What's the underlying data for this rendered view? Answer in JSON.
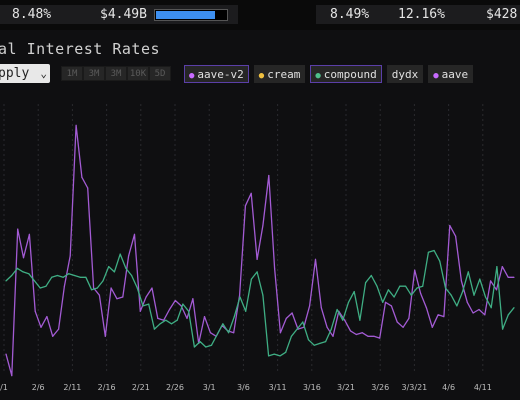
{
  "topbar": {
    "left": {
      "rate": "8.48%",
      "volume": "$4.49B",
      "fill": 0.82
    },
    "right": {
      "rate1": "8.49%",
      "rate2": "12.16%",
      "amount": "$428"
    }
  },
  "title": "al Interest Rates",
  "controls": {
    "select_value": "pply",
    "ranges": [
      "1M",
      "3M",
      "3M",
      "10K",
      "5D"
    ],
    "protocols": [
      {
        "label": "aave-v2",
        "dot": "#c86bff",
        "active": true
      },
      {
        "label": "cream",
        "dot": "#f0c040",
        "active": false
      },
      {
        "label": "compound",
        "dot": "#4ec08a",
        "active": true
      },
      {
        "label": "dydx",
        "dot": "",
        "active": false
      },
      {
        "label": "aave",
        "dot": "#c86bff",
        "active": false
      }
    ]
  },
  "colors": {
    "aave_v2": "#a35bd4",
    "compound": "#3fae84",
    "grid": "#2a2a2e",
    "axis_text": "#bdbdbd"
  },
  "chart_data": {
    "type": "line",
    "x_tick_labels": [
      "/1",
      "2/6",
      "2/11",
      "2/16",
      "2/21",
      "2/26",
      "3/1",
      "3/6",
      "3/11",
      "3/16",
      "3/21",
      "3/26",
      "3/3/21",
      "4/6",
      "4/11"
    ],
    "series": [
      {
        "name": "aave-v2",
        "values": [
          6,
          4.8,
          13,
          11.4,
          12.7,
          8.4,
          7.5,
          8.1,
          7,
          7.4,
          9.8,
          11.5,
          18.8,
          15.9,
          15.3,
          9.7,
          9.3,
          7,
          9.7,
          9.1,
          9.2,
          11.5,
          12.7,
          8.4,
          9.2,
          9.7,
          8,
          7.9,
          8.5,
          9,
          8.7,
          8,
          9.1,
          6.6,
          8.1,
          7.2,
          7,
          7.6,
          7.3,
          7.2,
          9.3,
          14.3,
          15,
          11.3,
          13.2,
          16,
          10.8,
          7.2,
          8,
          8.3,
          7.4,
          7.5,
          8.7,
          11.3,
          8.6,
          7.5,
          7,
          8.4,
          7.9,
          7.3,
          7.1,
          7.2,
          7,
          7,
          6.9,
          8.9,
          8.7,
          7.8,
          7.5,
          8,
          10.7,
          9.4,
          8.6,
          7.5,
          8.2,
          8.1,
          13.2,
          12.6,
          10.1,
          8.9,
          8.3,
          8.5,
          8.2,
          10.1,
          9.6,
          10.9,
          10.3,
          10.3
        ]
      },
      {
        "name": "compound",
        "values": [
          10.1,
          10.4,
          10.8,
          10.6,
          10.5,
          10.1,
          9.7,
          9.8,
          10.3,
          10.4,
          10.3,
          10.5,
          10.4,
          10.3,
          10.3,
          9.6,
          9.7,
          10.1,
          10.9,
          10.6,
          11.6,
          10.8,
          10.4,
          9.7,
          8.7,
          8.8,
          7.4,
          7.7,
          7.9,
          7.7,
          7.9,
          8.8,
          8.4,
          6.4,
          6.7,
          6.4,
          6.5,
          7.1,
          7.7,
          7.2,
          8.1,
          9.2,
          8.4,
          10.2,
          10.6,
          9.3,
          5.9,
          6,
          5.9,
          6.1,
          7,
          7.4,
          7.8,
          6.8,
          6.5,
          6.6,
          6.7,
          7.4,
          8.5,
          7.9,
          8.9,
          9.5,
          7.9,
          10,
          10.4,
          9.8,
          8.9,
          9.6,
          9.2,
          9.8,
          9.8,
          9.3,
          9.7,
          9.8,
          11.7,
          11.8,
          11.2,
          9.7,
          9.3,
          8.7,
          9.5,
          10.6,
          9.3,
          10.2,
          9.2,
          8.6,
          10.9,
          7.4,
          8.2,
          8.6
        ]
      }
    ],
    "ylim": [
      5,
      20
    ],
    "grid": true,
    "legend": "top-left"
  }
}
